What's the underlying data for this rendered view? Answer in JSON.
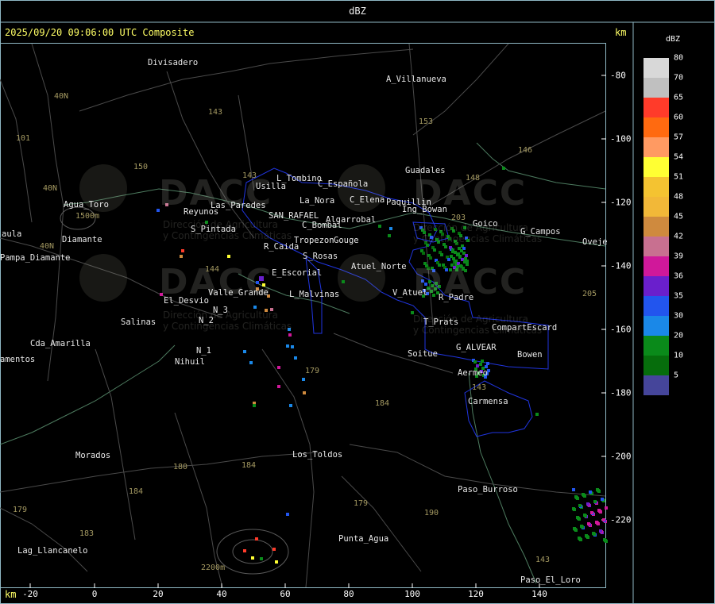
{
  "title": "dBZ",
  "timestamp": "2025/09/20 09:06:00 UTC Composite",
  "axis_unit": "km",
  "legend_unit": "dBZ",
  "x_ticks": [
    "-20",
    "0",
    "20",
    "40",
    "60",
    "80",
    "100",
    "120",
    "140"
  ],
  "y_ticks": [
    "-80",
    "-100",
    "-120",
    "-140",
    "-160",
    "-180",
    "-200",
    "-220"
  ],
  "legend": [
    {
      "value": "80",
      "color": "#d8d8d8"
    },
    {
      "value": "70",
      "color": "#c0c0c0"
    },
    {
      "value": "65",
      "color": "#ff3b2a"
    },
    {
      "value": "60",
      "color": "#ff6a10"
    },
    {
      "value": "57",
      "color": "#ff9a62"
    },
    {
      "value": "54",
      "color": "#ffff33"
    },
    {
      "value": "51",
      "color": "#f4c331"
    },
    {
      "value": "48",
      "color": "#f2b838"
    },
    {
      "value": "45",
      "color": "#cf8a3e"
    },
    {
      "value": "42",
      "color": "#c87090"
    },
    {
      "value": "39",
      "color": "#d0189a"
    },
    {
      "value": "36",
      "color": "#6a1fcc"
    },
    {
      "value": "35",
      "color": "#2255ee"
    },
    {
      "value": "30",
      "color": "#1a88e8"
    },
    {
      "value": "20",
      "color": "#0a8a1a"
    },
    {
      "value": "10",
      "color": "#066d0c"
    },
    {
      "value": "5",
      "color": "#45459a"
    }
  ],
  "watermark": {
    "brand": "DACC",
    "line1": "Dirección de Agricultura",
    "line2": "y Contingencias Climáticas"
  },
  "places": [
    "Divisadero",
    "A_Villanueva",
    "Guadales",
    "Goico",
    "G_Campos",
    "Oveje",
    "L_Tombino",
    "Usilla",
    "C_Española",
    "La_Nora",
    "C_Elena",
    "Paquillin",
    "Agua_Toro",
    "1500m",
    "Reyunos",
    "C_Bombal",
    "S_Pintada",
    "Las_Paredes",
    "SAN_RAFAEL",
    "Algarrobal",
    "Tropezon",
    "Gouge",
    "aula",
    "Pampa_Diamante",
    "Diamante",
    "R_Caida",
    "S_Rosas",
    "Atuel_Norte",
    "E_Escorial",
    "V_Atuel",
    "R_Padre",
    "Valle_Grande",
    "El_Desvio",
    "L_Malvinas",
    "Salinas",
    "N_2",
    "N_3",
    "T_Prats",
    "CompartEscard",
    "Cda_Amarilla",
    "N_1",
    "Nihuil",
    "Soitue",
    "G_ALVEAR",
    "Bowen",
    "Aermeo",
    "amentos",
    "Carmensa",
    "Morados",
    "Los_Toldos",
    "Paso_Burroso",
    "Punta_Agua",
    "Lag_Llancanelo",
    "2200m",
    "Paso_El_Loro",
    "Ing_Bowan"
  ],
  "routes": [
    "40N",
    "40N",
    "40N",
    "101",
    "143",
    "143",
    "153",
    "146",
    "148",
    "150",
    "203",
    "144",
    "179",
    "184",
    "180",
    "184",
    "184",
    "183",
    "179",
    "190",
    "143",
    "143",
    "179",
    "205"
  ]
}
